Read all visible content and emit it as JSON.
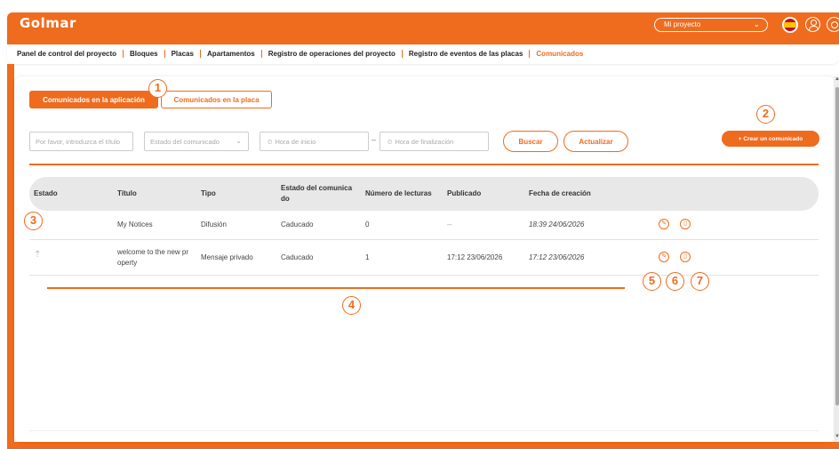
{
  "brand": {
    "logo": "Golmar",
    "accent": "#ef6b1d"
  },
  "header": {
    "project_select": "Mi proyecto",
    "project_chevron": "⌄",
    "user_icon": "user-icon",
    "settings_icon": "gear-icon"
  },
  "nav": {
    "items": [
      "Panel de control del proyecto",
      "Bloques",
      "Placas",
      "Apartamentos",
      "Registro de operaciones del proyecto",
      "Registro de eventos de las placas",
      "Comunicados"
    ],
    "active_index": 6
  },
  "tabs": {
    "app": "Comunicados en la aplicación",
    "panel": "Comunicados en la placa"
  },
  "filters": {
    "title_placeholder": "Por favor, introduzca el título",
    "status_placeholder": "Estado del comunicado",
    "start_placeholder": "Hora de inicio",
    "end_placeholder": "Hora de finalización",
    "separator": "–",
    "search_button": "Buscar",
    "refresh_button": "Actualizar",
    "create_button": "+ Crear un comunicado"
  },
  "table": {
    "headers": {
      "estado": "Estado",
      "titulo": "Título",
      "tipo": "Tipo",
      "estado_comunicado_1": "Estado del comunica",
      "estado_comunicado_2": "do",
      "lecturas": "Número de lecturas",
      "publicado": "Publicado",
      "fecha": "Fecha de creación"
    },
    "rows": [
      {
        "titulo_1": "My Notices",
        "titulo_2": "",
        "tipo": "Difusión",
        "estado": "Caducado",
        "lecturas": "0",
        "publicado": "--",
        "fecha": "18:39 24/06/2026",
        "pin": ""
      },
      {
        "titulo_1": "welcome to the new pr",
        "titulo_2": "operty",
        "tipo": "Mensaje privado",
        "estado": "Caducado",
        "lecturas": "1",
        "publicado": "17:12 23/06/2026",
        "fecha": "17:12 23/06/2026",
        "pin": "⇡"
      }
    ]
  },
  "icons": {
    "edit": "✎",
    "delete": "▯"
  },
  "callouts": [
    "1",
    "2",
    "3",
    "4",
    "5",
    "6",
    "7"
  ],
  "scrollbar": {
    "up": "▲",
    "down": "▼"
  }
}
